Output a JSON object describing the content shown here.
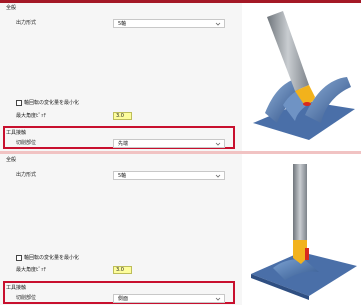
{
  "panels": [
    {
      "section_title": "全般",
      "output_format_label": "出力形式",
      "output_format_value": "5軸",
      "minimize_checkbox_label": "軸回転の変化量を最小化",
      "minimize_checked": false,
      "max_angle_label": "最大角度ﾋﾟｯﾁ",
      "max_angle_value": "3.0",
      "tool_section_title": "工具接触",
      "contact_label": "切削部位",
      "contact_value": "先端"
    },
    {
      "section_title": "全般",
      "output_format_label": "出力形式",
      "output_format_value": "5軸",
      "minimize_checkbox_label": "軸回転の変化量を最小化",
      "minimize_checked": false,
      "max_angle_label": "最大角度ﾋﾟｯﾁ",
      "max_angle_value": "3.0",
      "tool_section_title": "工具接触",
      "contact_label": "切削部位",
      "contact_value": "側面"
    }
  ],
  "colors": {
    "topbar": "#a41826",
    "highlight": "#c8102e",
    "input_bg": "#fdfd9c",
    "tool_shank": "#8f9499",
    "tool_tip": "#f2b21c",
    "part_blue": "#5f86b8",
    "contact_red": "#d82a1e"
  },
  "icons": [
    "chevron-down-icon",
    "checkbox-icon"
  ]
}
